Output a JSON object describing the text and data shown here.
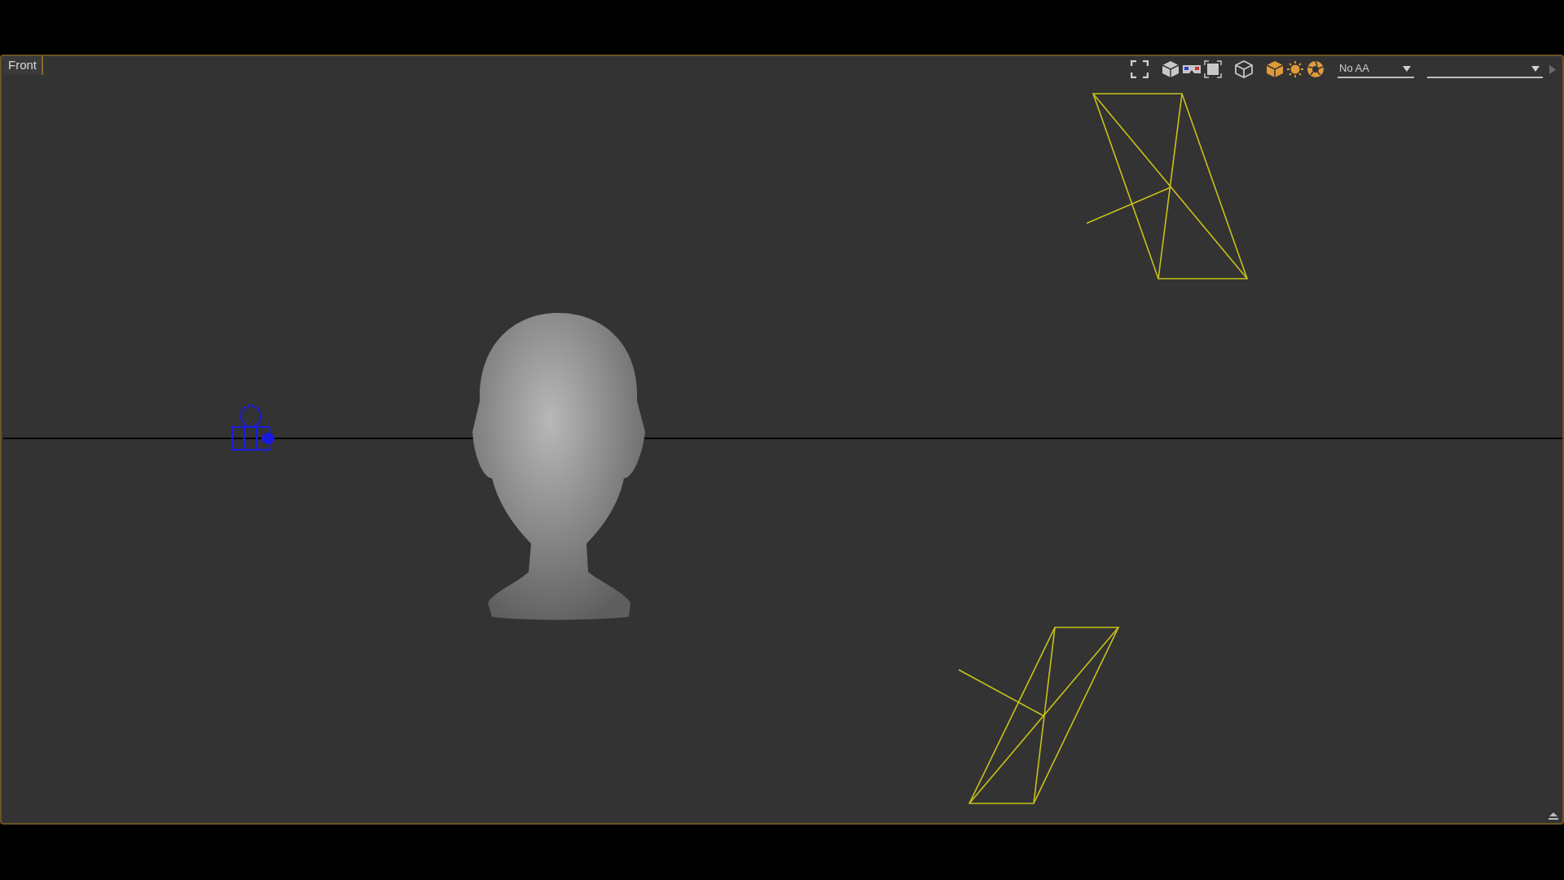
{
  "viewport": {
    "label": "Front"
  },
  "toolbar": {
    "aa_dropdown": {
      "value": "No AA"
    }
  }
}
